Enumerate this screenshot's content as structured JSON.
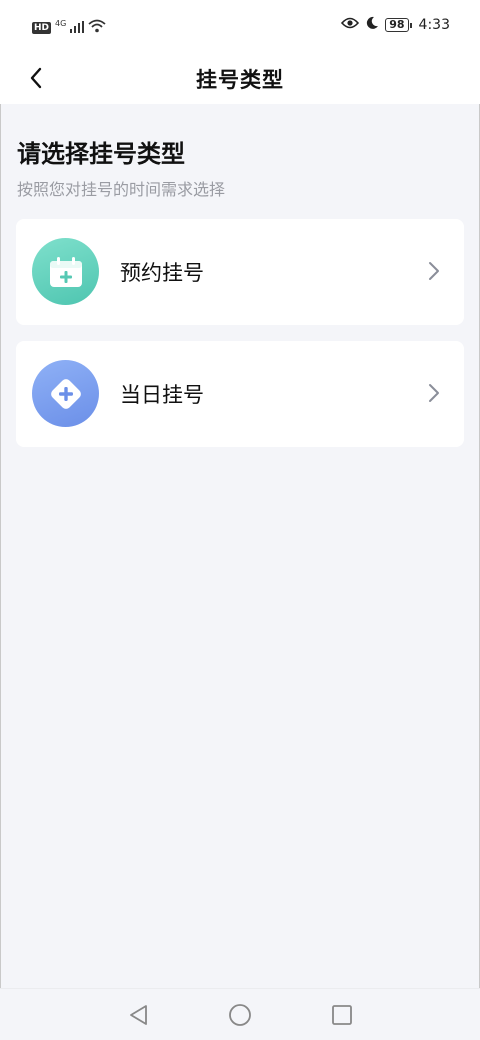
{
  "status_bar": {
    "hd_label": "HD",
    "network_label": "4G",
    "battery": "98",
    "time": "4:33"
  },
  "nav": {
    "title": "挂号类型"
  },
  "header": {
    "title": "请选择挂号类型",
    "subtitle": "按照您对挂号的时间需求选择"
  },
  "options": [
    {
      "label": "预约挂号",
      "icon": "calendar-plus-icon",
      "color": "#56c8b3"
    },
    {
      "label": "当日挂号",
      "icon": "diamond-plus-icon",
      "color": "#7298ea"
    }
  ],
  "colors": {
    "background": "#f4f5f9",
    "subtitle_gray": "#9a9ca3",
    "chevron": "#8a8e99"
  }
}
